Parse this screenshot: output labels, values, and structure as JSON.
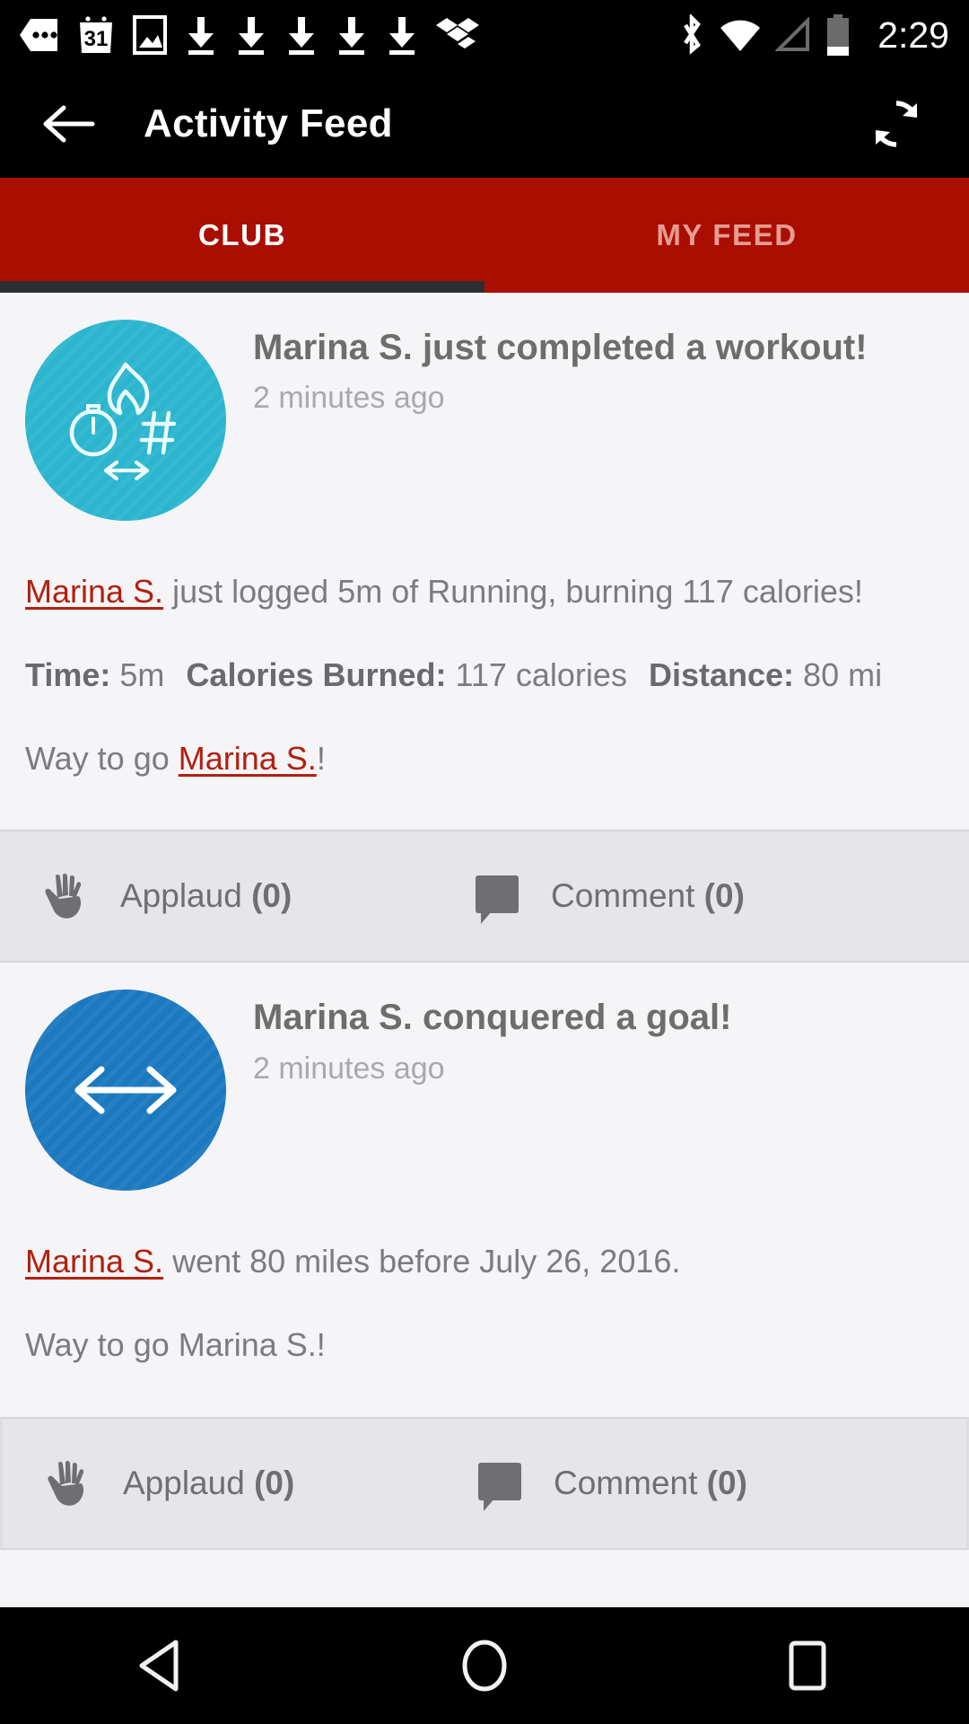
{
  "status_bar": {
    "icons": [
      "sim-tag-icon",
      "calendar-31-icon",
      "photo-icon",
      "download-icon",
      "download-icon",
      "download-icon",
      "download-icon",
      "download-icon",
      "dropbox-icon"
    ],
    "right_icons": [
      "bluetooth-icon",
      "wifi-icon",
      "cell-signal-icon",
      "battery-icon"
    ],
    "calendar_day": "31",
    "time": "2:29"
  },
  "app_bar": {
    "back_icon": "arrow-left-icon",
    "title": "Activity Feed",
    "refresh_icon": "refresh-icon"
  },
  "tabs": {
    "items": [
      {
        "label": "CLUB",
        "active": true
      },
      {
        "label": "MY FEED",
        "active": false
      }
    ],
    "indicator_color": "#2b2f33",
    "bar_color": "#aa0e01"
  },
  "feed": {
    "cards": [
      {
        "avatar": {
          "color": "#2bb5ce",
          "icons": [
            "flame-icon",
            "stopwatch-icon",
            "hashtag-icon",
            "double-arrow-icon"
          ]
        },
        "title": "Marina S. just completed a workout!",
        "time": "2 minutes ago",
        "summary": {
          "user": "Marina S.",
          "text": " just logged 5m of Running, burning 117 calories!"
        },
        "stats": [
          {
            "label": "Time:",
            "value": "5m"
          },
          {
            "label": "Calories Burned:",
            "value": "117 calories"
          },
          {
            "label": "Distance:",
            "value": "80 mi"
          }
        ],
        "closing": {
          "prefix": "Way to go ",
          "user": "Marina S.",
          "suffix": "!"
        },
        "actions": {
          "applaud": {
            "icon": "applaud-hands-icon",
            "label": "Applaud",
            "count": "(0)"
          },
          "comment": {
            "icon": "comment-bubble-icon",
            "label": "Comment",
            "count": "(0)"
          }
        }
      },
      {
        "avatar": {
          "color": "#1b79c0",
          "icons": [
            "double-arrow-icon"
          ]
        },
        "title": "Marina S. conquered a goal!",
        "time": "2 minutes ago",
        "summary": {
          "user": "Marina S.",
          "text": " went 80 miles before July 26, 2016."
        },
        "closing_plain": "Way to go Marina S.!",
        "actions": {
          "applaud": {
            "icon": "applaud-hands-icon",
            "label": "Applaud",
            "count": "(0)"
          },
          "comment": {
            "icon": "comment-bubble-icon",
            "label": "Comment",
            "count": "(0)"
          }
        }
      }
    ]
  },
  "nav_bar": {
    "back": "nav-back-triangle-icon",
    "home": "nav-home-circle-icon",
    "recents": "nav-recents-square-icon"
  }
}
